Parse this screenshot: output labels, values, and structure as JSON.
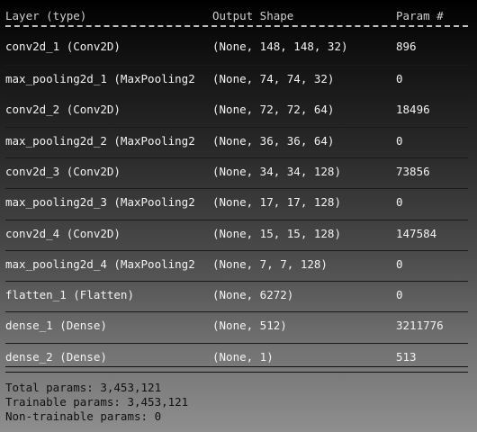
{
  "header": {
    "layer": "Layer (type)",
    "output": "Output Shape",
    "params": "Param #"
  },
  "layers": [
    {
      "name": "conv2d_1 (Conv2D)",
      "shape": "(None, 148, 148, 32)",
      "params": "896"
    },
    {
      "name": "max_pooling2d_1 (MaxPooling2",
      "shape": "(None, 74, 74, 32)",
      "params": "0"
    },
    {
      "name": "conv2d_2 (Conv2D)",
      "shape": "(None, 72, 72, 64)",
      "params": "18496"
    },
    {
      "name": "max_pooling2d_2 (MaxPooling2",
      "shape": "(None, 36, 36, 64)",
      "params": "0"
    },
    {
      "name": "conv2d_3 (Conv2D)",
      "shape": "(None, 34, 34, 128)",
      "params": "73856"
    },
    {
      "name": "max_pooling2d_3 (MaxPooling2",
      "shape": "(None, 17, 17, 128)",
      "params": "0"
    },
    {
      "name": "conv2d_4 (Conv2D)",
      "shape": "(None, 15, 15, 128)",
      "params": "147584"
    },
    {
      "name": "max_pooling2d_4 (MaxPooling2",
      "shape": "(None, 7, 7, 128)",
      "params": "0"
    },
    {
      "name": "flatten_1 (Flatten)",
      "shape": "(None, 6272)",
      "params": "0"
    },
    {
      "name": "dense_1 (Dense)",
      "shape": "(None, 512)",
      "params": "3211776"
    },
    {
      "name": "dense_2 (Dense)",
      "shape": "(None, 1)",
      "params": "513"
    }
  ],
  "totals": {
    "total": "Total params: 3,453,121",
    "trainable": "Trainable params: 3,453,121",
    "non_trainable": "Non-trainable params: 0"
  }
}
